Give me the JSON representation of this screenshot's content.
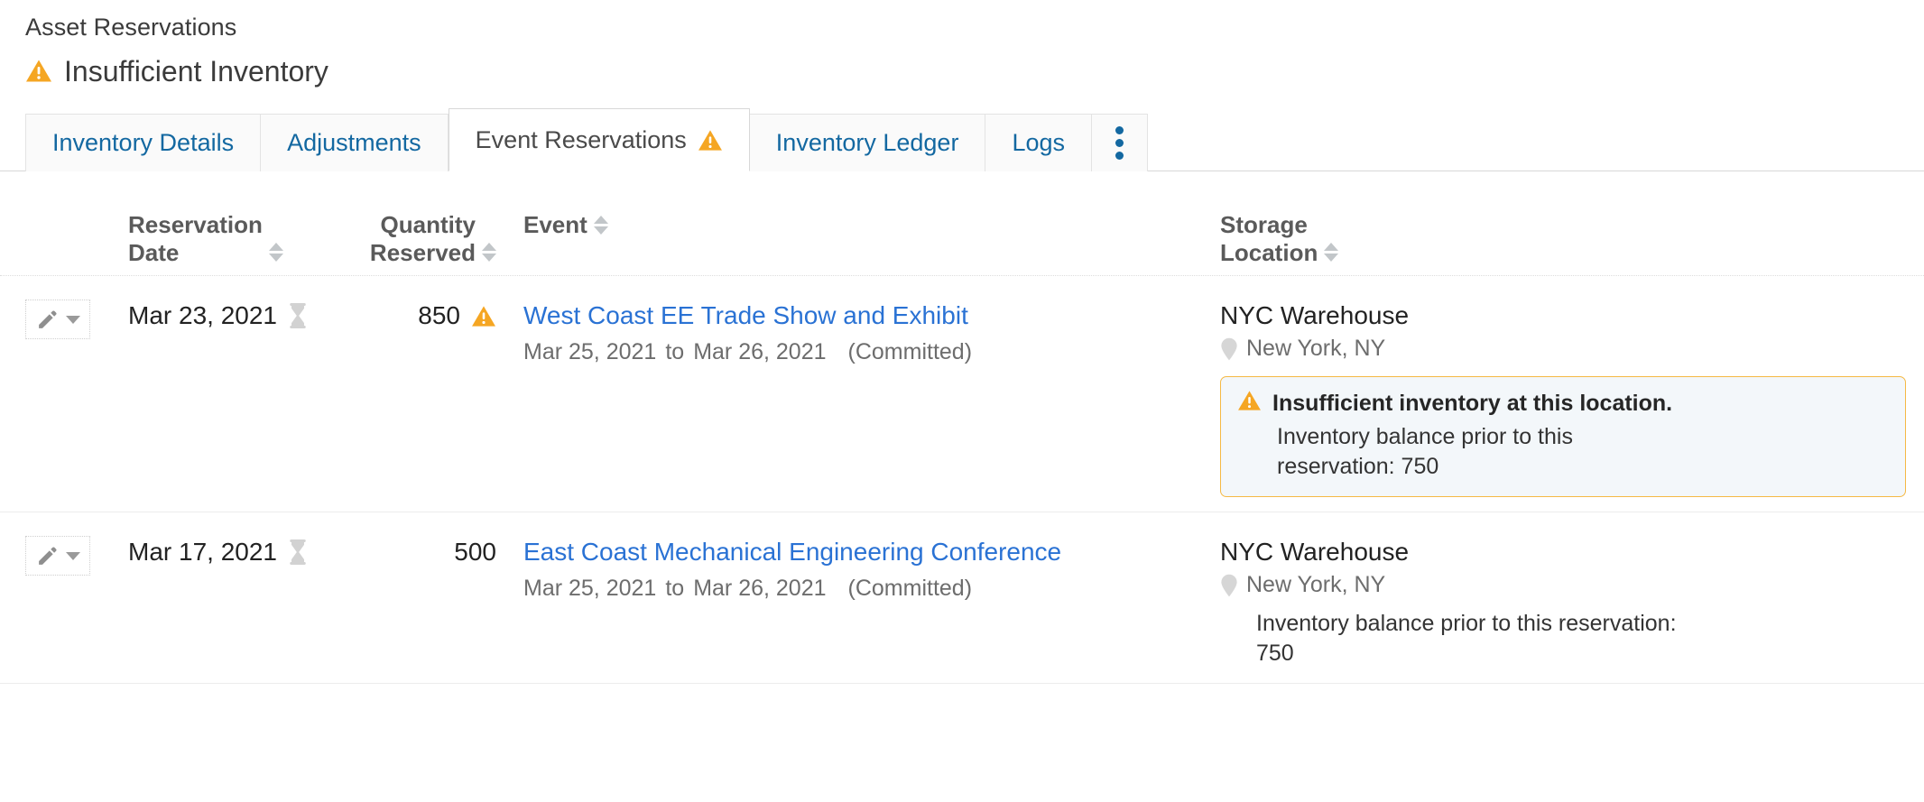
{
  "header": {
    "breadcrumb": "Asset Reservations",
    "title": "Insufficient Inventory",
    "warning_icon": "warning-triangle-icon"
  },
  "tabs": [
    {
      "label": "Inventory Details",
      "active": false,
      "warning": false
    },
    {
      "label": "Adjustments",
      "active": false,
      "warning": false
    },
    {
      "label": "Event Reservations",
      "active": true,
      "warning": true
    },
    {
      "label": "Inventory Ledger",
      "active": false,
      "warning": false
    },
    {
      "label": "Logs",
      "active": false,
      "warning": false
    }
  ],
  "overflow_menu": {
    "icon": "kebab-menu-icon"
  },
  "table": {
    "columns": [
      {
        "line1": "Reservation",
        "line2": "Date",
        "sortable": true
      },
      {
        "line1": "Quantity",
        "line2": "Reserved",
        "sortable": true
      },
      {
        "line1": "",
        "line2": "Event",
        "sortable": true
      },
      {
        "line1": "Storage",
        "line2": "Location",
        "sortable": true
      }
    ],
    "rows": [
      {
        "edit_action": "Edit",
        "reservation_date": "Mar 23, 2021",
        "date_icon": "hourglass-icon",
        "quantity_reserved": "850",
        "quantity_warning": true,
        "event_name": "West Coast EE Trade Show and Exhibit",
        "event_start": "Mar 25, 2021",
        "event_to": "to",
        "event_end": "Mar 26, 2021",
        "event_status": "(Committed)",
        "location_name": "NYC Warehouse",
        "location_city": "New York, NY",
        "location_icon": "map-pin-icon",
        "callout": {
          "show": true,
          "title": "Insufficient inventory at this location.",
          "body": "Inventory balance prior to this reservation: 750"
        }
      },
      {
        "edit_action": "Edit",
        "reservation_date": "Mar 17, 2021",
        "date_icon": "hourglass-icon",
        "quantity_reserved": "500",
        "quantity_warning": false,
        "event_name": "East Coast Mechanical Engineering Conference",
        "event_start": "Mar 25, 2021",
        "event_to": "to",
        "event_end": "Mar 26, 2021",
        "event_status": "(Committed)",
        "location_name": "NYC Warehouse",
        "location_city": "New York, NY",
        "location_icon": "map-pin-icon",
        "callout": {
          "show": false,
          "title": "",
          "body": "Inventory balance prior to this reservation: 750"
        }
      }
    ]
  },
  "colors": {
    "warning": "#f5a623",
    "link": "#2a72d4",
    "tab_link": "#1368a1",
    "callout_bg": "#f3f7fa",
    "callout_border": "#f5b945"
  }
}
